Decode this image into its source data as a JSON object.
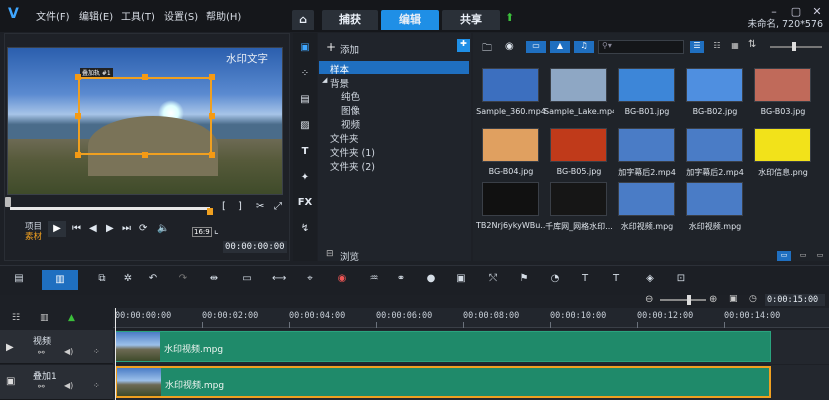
{
  "titlebar": {
    "menus": [
      "文件(F)",
      "编辑(E)",
      "工具(T)",
      "设置(S)",
      "帮助(H)"
    ],
    "tabs": [
      "捕获",
      "编辑",
      "共享"
    ],
    "project_info": "未命名, 720*576",
    "active_tab": "编辑"
  },
  "preview": {
    "watermark_text": "水印文字",
    "overlay_label": "叠加轨 #1",
    "mode_labels": [
      "项目",
      "素材"
    ],
    "aspect": "16:9",
    "timecode": "00:00:00:00"
  },
  "library": {
    "add_label": "添加",
    "browse_label": "浏览",
    "tree": [
      "样本",
      "背景",
      "纯色",
      "图像",
      "视频",
      "文件夹",
      "文件夹 (1)",
      "文件夹 (2)"
    ],
    "search_placeholder": "▾",
    "items": [
      {
        "name": "Sample_360.mp4",
        "bg": "#3c6fbf"
      },
      {
        "name": "Sample_Lake.mp4",
        "bg": "#8ea7c4"
      },
      {
        "name": "BG-B01.jpg",
        "bg": "#3d86d8"
      },
      {
        "name": "BG-B02.jpg",
        "bg": "#4f8fe0"
      },
      {
        "name": "BG-B03.jpg",
        "bg": "#c06a5a"
      },
      {
        "name": "BG-B04.jpg",
        "bg": "#e0a060"
      },
      {
        "name": "BG-B05.jpg",
        "bg": "#c03a1a"
      },
      {
        "name": "加字幕后2.mp4",
        "bg": "#4a7cc6"
      },
      {
        "name": "加字幕后2.mp4",
        "bg": "#4a7cc6"
      },
      {
        "name": "水印信息.png",
        "bg": "#f2e21a"
      },
      {
        "name": "TB2Nrj6ykyWBu...",
        "bg": "#111111"
      },
      {
        "name": "千库网_网格水印...",
        "bg": "#161616"
      },
      {
        "name": "水印视频.mpg",
        "bg": "#4a7cc6"
      },
      {
        "name": "水印视频.mpg",
        "bg": "#4a7cc6"
      }
    ]
  },
  "timeline": {
    "zoom_timecode": "0:00:15:00",
    "ruler": [
      "00:00:00:00",
      "00:00:02:00",
      "00:00:04:00",
      "00:00:06:00",
      "00:00:08:00",
      "00:00:10:00",
      "00:00:12:00",
      "00:00:14:00"
    ],
    "tracks": [
      {
        "name": "视频",
        "clip": "水印视频.mpg"
      },
      {
        "name": "叠加1",
        "clip": "水印视频.mpg"
      }
    ]
  },
  "colors": {
    "accent": "#1f8fe6",
    "clip": "#1f8a6a",
    "selection": "#f0a020"
  }
}
